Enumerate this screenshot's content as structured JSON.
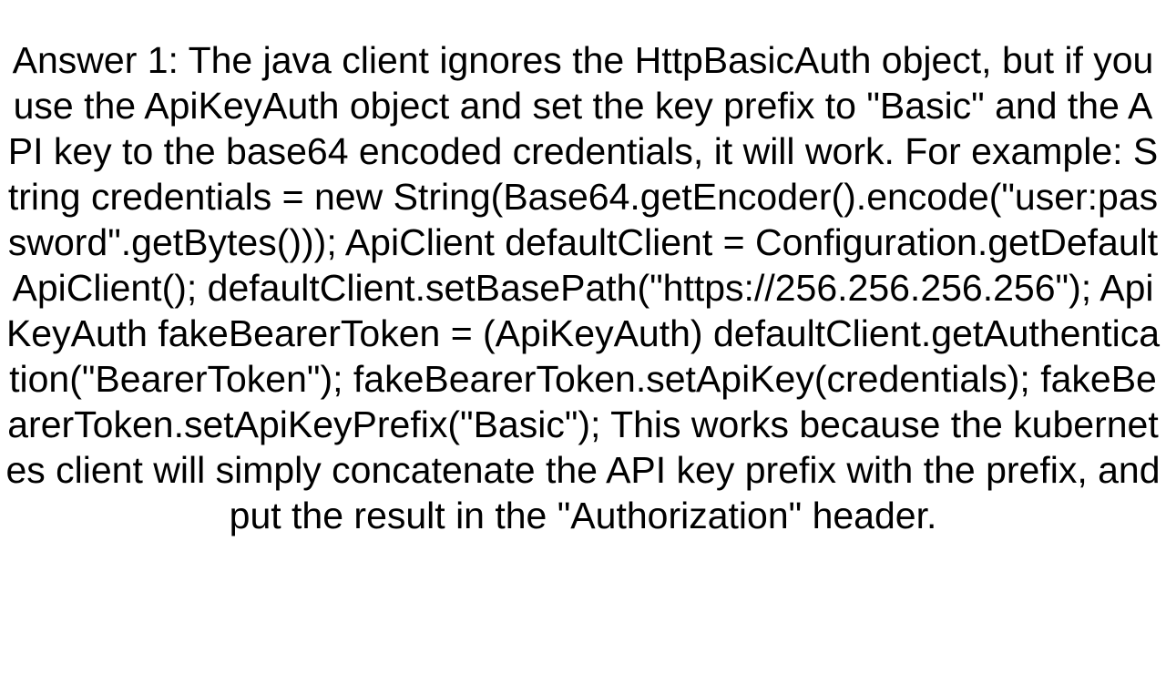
{
  "answer": {
    "text": "Answer 1: The java client ignores the HttpBasicAuth object, but if you use the ApiKeyAuth object and set the key prefix to \"Basic\" and the API key to the base64 encoded credentials, it will work. For example: String credentials = new String(Base64.getEncoder().encode(\"user:password\".getBytes())); ApiClient defaultClient = Configuration.getDefaultApiClient(); defaultClient.setBasePath(\"https://256.256.256.256\"); ApiKeyAuth fakeBearerToken = (ApiKeyAuth) defaultClient.getAuthentication(\"BearerToken\"); fakeBearerToken.setApiKey(credentials); fakeBearerToken.setApiKeyPrefix(\"Basic\");  This works because the kubernetes client will simply concatenate the API key prefix with the prefix, and put the result in the \"Authorization\" header."
  }
}
